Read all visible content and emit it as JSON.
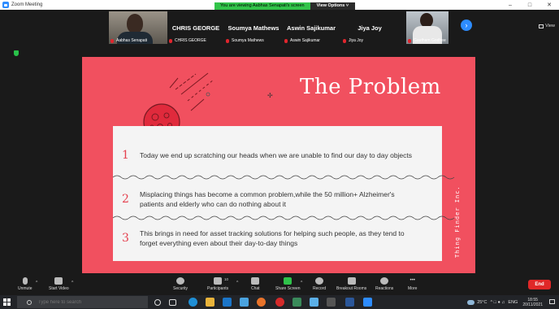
{
  "window": {
    "title": "Zoom Meeting",
    "controls": [
      "–",
      "□",
      "✕"
    ]
  },
  "share_banner": {
    "message": "You are viewing Aabhas Senapati's screen",
    "view_options": "View Options ˅"
  },
  "view_button": "View",
  "participants": [
    {
      "name": "",
      "label": "Aabhas Senapati",
      "video": true
    },
    {
      "name": "CHRIS GEORGE",
      "label": "CHRIS GEORGE",
      "video": false
    },
    {
      "name": "Soumya Mathews",
      "label": "Soumya Mathews",
      "video": false
    },
    {
      "name": "Aswin Sajikumar",
      "label": "Aswin Sajikumar",
      "video": false
    },
    {
      "name": "Jiya Joy",
      "label": "Jiya Joy",
      "video": false
    },
    {
      "name": "",
      "label": "Gautham Godhee",
      "video": true
    }
  ],
  "slide": {
    "title": "The Problem",
    "side_text": "Thing Finder Inc.",
    "cursor": "✢",
    "items": [
      {
        "num": "1",
        "text": "Today we end up scratching our heads when we are unable to find our day to day objects"
      },
      {
        "num": "2",
        "text": "Misplacing  things has become a common problem,while the 50 million+ Alzheimer's patients and elderly who can do nothing about it"
      },
      {
        "num": "3",
        "text": "This brings in need for asset tracking solutions for helping such people, as they tend to forget everything even about their day-to-day things"
      }
    ]
  },
  "controls": {
    "unmute": "Unmute",
    "start_video": "Start Video",
    "security": "Security",
    "participants": "Participants",
    "participants_count": "10",
    "chat": "Chat",
    "share_screen": "Share Screen",
    "record": "Record",
    "breakout_rooms": "Breakout Rooms",
    "reactions": "Reactions",
    "more": "More",
    "more_dots": "•••",
    "end": "End"
  },
  "taskbar": {
    "search_placeholder": "Type here to search",
    "weather": "25°C",
    "language": "ENG",
    "time": "18:55",
    "date": "20/11/2021"
  },
  "colors": {
    "slide_bg": "#f1505f",
    "number_color": "#e5414f",
    "share_green": "#32c44a",
    "end_red": "#e02828",
    "zoom_blue": "#2d8cff"
  }
}
